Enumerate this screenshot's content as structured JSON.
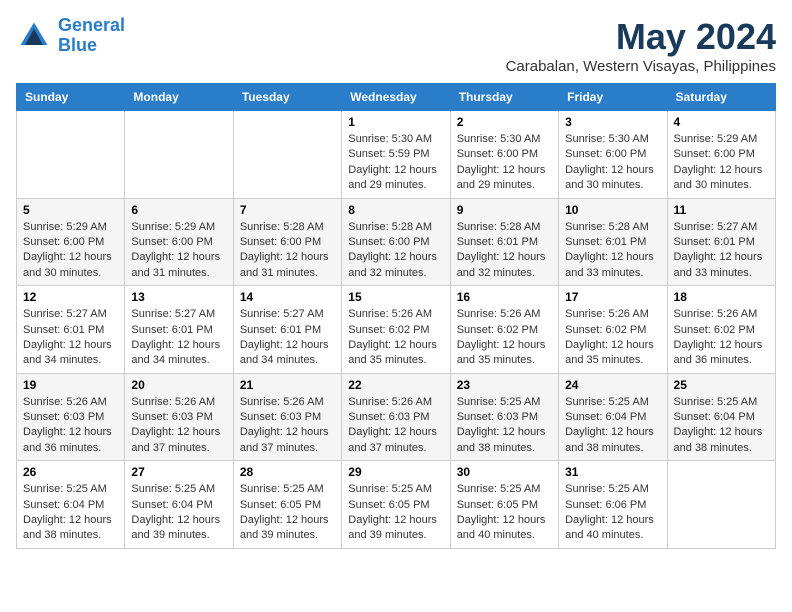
{
  "header": {
    "logo_line1": "General",
    "logo_line2": "Blue",
    "month": "May 2024",
    "location": "Carabalan, Western Visayas, Philippines"
  },
  "weekdays": [
    "Sunday",
    "Monday",
    "Tuesday",
    "Wednesday",
    "Thursday",
    "Friday",
    "Saturday"
  ],
  "weeks": [
    [
      {
        "day": "",
        "info": ""
      },
      {
        "day": "",
        "info": ""
      },
      {
        "day": "",
        "info": ""
      },
      {
        "day": "1",
        "info": "Sunrise: 5:30 AM\nSunset: 5:59 PM\nDaylight: 12 hours\nand 29 minutes."
      },
      {
        "day": "2",
        "info": "Sunrise: 5:30 AM\nSunset: 6:00 PM\nDaylight: 12 hours\nand 29 minutes."
      },
      {
        "day": "3",
        "info": "Sunrise: 5:30 AM\nSunset: 6:00 PM\nDaylight: 12 hours\nand 30 minutes."
      },
      {
        "day": "4",
        "info": "Sunrise: 5:29 AM\nSunset: 6:00 PM\nDaylight: 12 hours\nand 30 minutes."
      }
    ],
    [
      {
        "day": "5",
        "info": "Sunrise: 5:29 AM\nSunset: 6:00 PM\nDaylight: 12 hours\nand 30 minutes."
      },
      {
        "day": "6",
        "info": "Sunrise: 5:29 AM\nSunset: 6:00 PM\nDaylight: 12 hours\nand 31 minutes."
      },
      {
        "day": "7",
        "info": "Sunrise: 5:28 AM\nSunset: 6:00 PM\nDaylight: 12 hours\nand 31 minutes."
      },
      {
        "day": "8",
        "info": "Sunrise: 5:28 AM\nSunset: 6:00 PM\nDaylight: 12 hours\nand 32 minutes."
      },
      {
        "day": "9",
        "info": "Sunrise: 5:28 AM\nSunset: 6:01 PM\nDaylight: 12 hours\nand 32 minutes."
      },
      {
        "day": "10",
        "info": "Sunrise: 5:28 AM\nSunset: 6:01 PM\nDaylight: 12 hours\nand 33 minutes."
      },
      {
        "day": "11",
        "info": "Sunrise: 5:27 AM\nSunset: 6:01 PM\nDaylight: 12 hours\nand 33 minutes."
      }
    ],
    [
      {
        "day": "12",
        "info": "Sunrise: 5:27 AM\nSunset: 6:01 PM\nDaylight: 12 hours\nand 34 minutes."
      },
      {
        "day": "13",
        "info": "Sunrise: 5:27 AM\nSunset: 6:01 PM\nDaylight: 12 hours\nand 34 minutes."
      },
      {
        "day": "14",
        "info": "Sunrise: 5:27 AM\nSunset: 6:01 PM\nDaylight: 12 hours\nand 34 minutes."
      },
      {
        "day": "15",
        "info": "Sunrise: 5:26 AM\nSunset: 6:02 PM\nDaylight: 12 hours\nand 35 minutes."
      },
      {
        "day": "16",
        "info": "Sunrise: 5:26 AM\nSunset: 6:02 PM\nDaylight: 12 hours\nand 35 minutes."
      },
      {
        "day": "17",
        "info": "Sunrise: 5:26 AM\nSunset: 6:02 PM\nDaylight: 12 hours\nand 35 minutes."
      },
      {
        "day": "18",
        "info": "Sunrise: 5:26 AM\nSunset: 6:02 PM\nDaylight: 12 hours\nand 36 minutes."
      }
    ],
    [
      {
        "day": "19",
        "info": "Sunrise: 5:26 AM\nSunset: 6:03 PM\nDaylight: 12 hours\nand 36 minutes."
      },
      {
        "day": "20",
        "info": "Sunrise: 5:26 AM\nSunset: 6:03 PM\nDaylight: 12 hours\nand 37 minutes."
      },
      {
        "day": "21",
        "info": "Sunrise: 5:26 AM\nSunset: 6:03 PM\nDaylight: 12 hours\nand 37 minutes."
      },
      {
        "day": "22",
        "info": "Sunrise: 5:26 AM\nSunset: 6:03 PM\nDaylight: 12 hours\nand 37 minutes."
      },
      {
        "day": "23",
        "info": "Sunrise: 5:25 AM\nSunset: 6:03 PM\nDaylight: 12 hours\nand 38 minutes."
      },
      {
        "day": "24",
        "info": "Sunrise: 5:25 AM\nSunset: 6:04 PM\nDaylight: 12 hours\nand 38 minutes."
      },
      {
        "day": "25",
        "info": "Sunrise: 5:25 AM\nSunset: 6:04 PM\nDaylight: 12 hours\nand 38 minutes."
      }
    ],
    [
      {
        "day": "26",
        "info": "Sunrise: 5:25 AM\nSunset: 6:04 PM\nDaylight: 12 hours\nand 38 minutes."
      },
      {
        "day": "27",
        "info": "Sunrise: 5:25 AM\nSunset: 6:04 PM\nDaylight: 12 hours\nand 39 minutes."
      },
      {
        "day": "28",
        "info": "Sunrise: 5:25 AM\nSunset: 6:05 PM\nDaylight: 12 hours\nand 39 minutes."
      },
      {
        "day": "29",
        "info": "Sunrise: 5:25 AM\nSunset: 6:05 PM\nDaylight: 12 hours\nand 39 minutes."
      },
      {
        "day": "30",
        "info": "Sunrise: 5:25 AM\nSunset: 6:05 PM\nDaylight: 12 hours\nand 40 minutes."
      },
      {
        "day": "31",
        "info": "Sunrise: 5:25 AM\nSunset: 6:06 PM\nDaylight: 12 hours\nand 40 minutes."
      },
      {
        "day": "",
        "info": ""
      }
    ]
  ]
}
